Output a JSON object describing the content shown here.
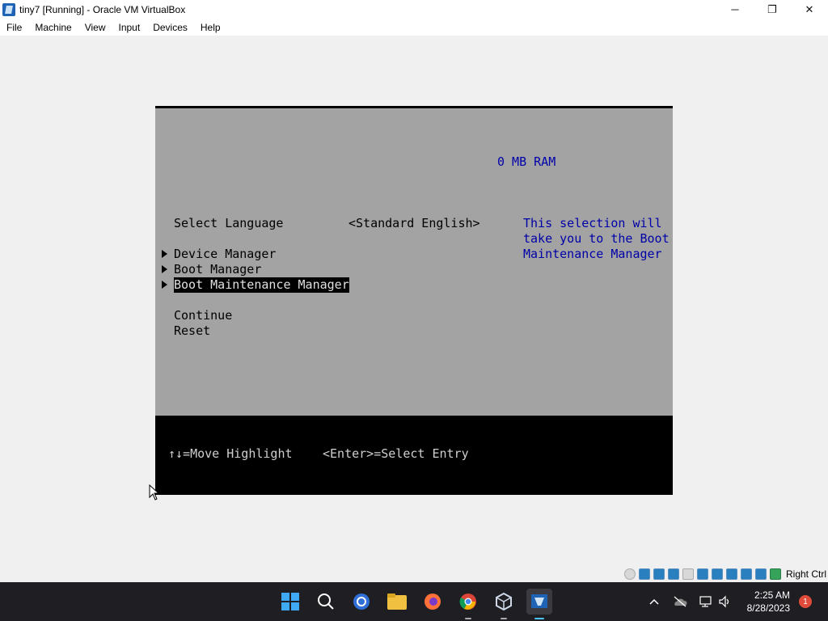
{
  "window": {
    "title": "tiny7 [Running] - Oracle VM VirtualBox",
    "controls": {
      "minimize": "─",
      "maximize": "❐",
      "close": "✕"
    }
  },
  "menu": [
    "File",
    "Machine",
    "View",
    "Input",
    "Devices",
    "Help"
  ],
  "bios": {
    "ram": "0 MB RAM",
    "language_label": "Select Language",
    "language_value": "<Standard English>",
    "items": [
      "Device Manager",
      "Boot Manager",
      "Boot Maintenance Manager"
    ],
    "selected_index": 2,
    "actions": [
      "Continue",
      "Reset"
    ],
    "help_lines": [
      "This selection will",
      "take you to the Boot",
      "Maintenance Manager"
    ],
    "footer_move": "↑↓=Move Highlight",
    "footer_select": "<Enter>=Select Entry"
  },
  "statusbar": {
    "icons": [
      "optical-drive-icon",
      "usb-icon",
      "network-icon",
      "shared-folders-icon",
      "display-icon",
      "video-capture-icon",
      "screen-icon",
      "vm-icon",
      "vram-icon",
      "mouse-integration-icon",
      "host-key-icon"
    ],
    "host_key": "Right Ctrl"
  },
  "taskbar": {
    "apps": [
      "start-icon",
      "search-icon",
      "cortana-icon",
      "file-explorer-icon",
      "firefox-icon",
      "chrome-icon",
      "virtualbox-manager-icon",
      "virtualbox-vm-icon"
    ],
    "time": "2:25 AM",
    "date": "8/28/2023",
    "notifications": "1"
  },
  "colors": {
    "bios_grey": "#a3a3a3",
    "bios_blue": "#0000a8",
    "taskbar": "#1f1f23"
  }
}
